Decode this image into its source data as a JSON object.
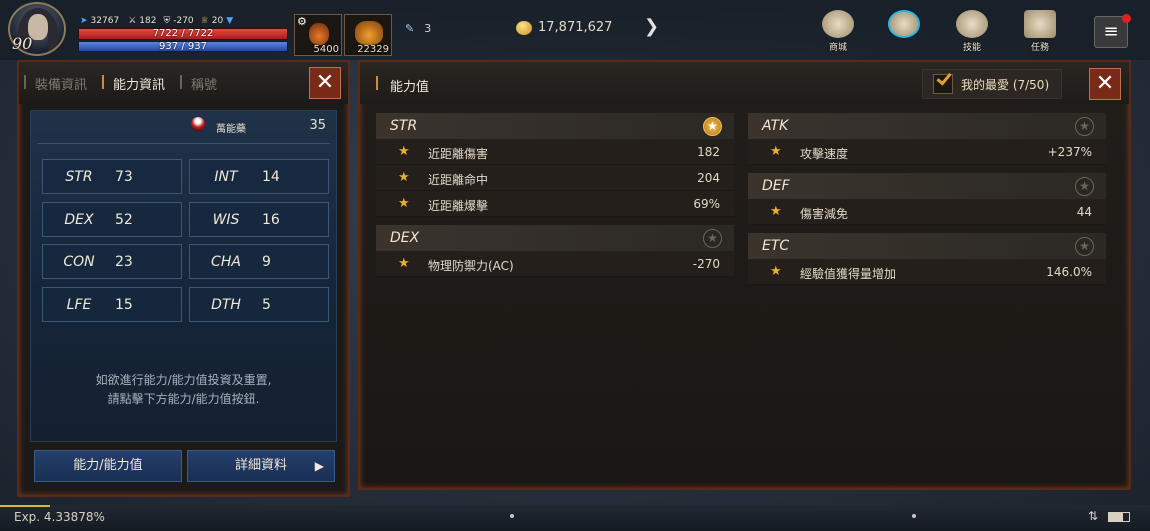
{
  "player": {
    "level": "90",
    "power": "32767",
    "stat_a": "182",
    "stat_b": "-270",
    "stat_c": "20",
    "hp_text": "7722 / 7722",
    "hp_fraction": 1.0,
    "mp_text": "937 / 937",
    "mp_fraction": 1.0
  },
  "quickslots": [
    {
      "name": "potion-slot",
      "qty": "5400"
    },
    {
      "name": "pouch-slot",
      "qty": "22329"
    }
  ],
  "crystal_count": "3",
  "gold": "17,871,627",
  "top_menu": [
    {
      "name": "shop",
      "label": "商城"
    },
    {
      "name": "clan",
      "label": ""
    },
    {
      "name": "skills",
      "label": "技能"
    },
    {
      "name": "quests",
      "label": "任務"
    }
  ],
  "left_panel": {
    "tabs": [
      "裝備資訊",
      "能力資訊",
      "稱號"
    ],
    "active_tab": 1,
    "mood_label": "萬能藥",
    "mood_value": "35",
    "stats": [
      {
        "key": "STR",
        "value": "73"
      },
      {
        "key": "INT",
        "value": "14"
      },
      {
        "key": "DEX",
        "value": "52"
      },
      {
        "key": "WIS",
        "value": "16"
      },
      {
        "key": "CON",
        "value": "23"
      },
      {
        "key": "CHA",
        "value": "9"
      },
      {
        "key": "LFE",
        "value": "15"
      },
      {
        "key": "DTH",
        "value": "5"
      }
    ],
    "hint_line1": "如欲進行能力/能力值投資及重置,",
    "hint_line2": "請點擊下方能力/能力值按鈕.",
    "btn_ability": "能力/能力值",
    "btn_detail": "詳細資料"
  },
  "right_panel": {
    "title": "能力值",
    "favorites_label": "我的最愛 (7/50)",
    "groups_left": [
      {
        "name": "STR",
        "starred": true,
        "rows": [
          {
            "label": "近距離傷害",
            "value": "182"
          },
          {
            "label": "近距離命中",
            "value": "204"
          },
          {
            "label": "近距離爆擊",
            "value": "69%"
          }
        ]
      },
      {
        "name": "DEX",
        "starred": false,
        "rows": [
          {
            "label": "物理防禦力(AC)",
            "value": "-270"
          }
        ]
      }
    ],
    "groups_right": [
      {
        "name": "ATK",
        "starred": false,
        "rows": [
          {
            "label": "攻擊速度",
            "value": "+237%"
          }
        ]
      },
      {
        "name": "DEF",
        "starred": false,
        "rows": [
          {
            "label": "傷害減免",
            "value": "44"
          }
        ]
      },
      {
        "name": "ETC",
        "starred": false,
        "rows": [
          {
            "label": "經驗值獲得量增加",
            "value": "146.0%"
          }
        ]
      }
    ]
  },
  "exp": {
    "text": "Exp. 4.33878%",
    "fraction": 0.0434
  }
}
